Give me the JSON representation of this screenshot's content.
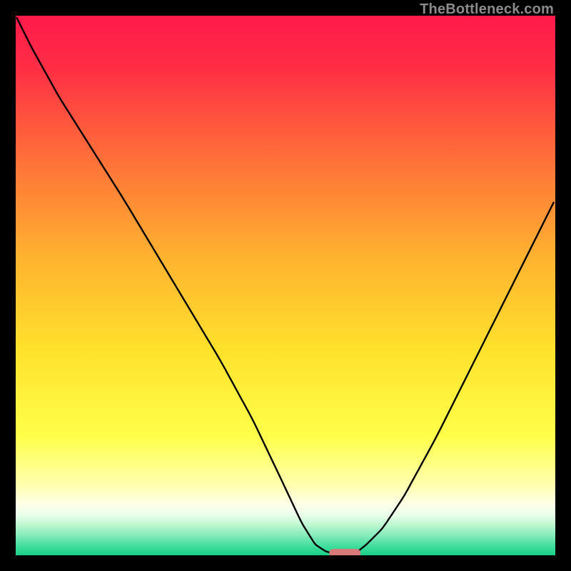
{
  "watermark": "TheBottleneck.com",
  "colors": {
    "frame": "#000000",
    "curve": "#000000",
    "marker": "#d87a7a",
    "gradient_stops": [
      {
        "offset": 0.0,
        "color": "#ff1a4b"
      },
      {
        "offset": 0.1,
        "color": "#ff2f45"
      },
      {
        "offset": 0.25,
        "color": "#ff6a3a"
      },
      {
        "offset": 0.45,
        "color": "#ffb330"
      },
      {
        "offset": 0.62,
        "color": "#ffe22c"
      },
      {
        "offset": 0.78,
        "color": "#ffff4a"
      },
      {
        "offset": 0.87,
        "color": "#ffffb0"
      },
      {
        "offset": 0.905,
        "color": "#ffffe8"
      },
      {
        "offset": 0.925,
        "color": "#eaffea"
      },
      {
        "offset": 0.945,
        "color": "#baf7cf"
      },
      {
        "offset": 0.965,
        "color": "#7fe9b8"
      },
      {
        "offset": 0.985,
        "color": "#3bdc9b"
      },
      {
        "offset": 1.0,
        "color": "#18cf86"
      }
    ]
  },
  "chart_data": {
    "type": "line",
    "title": "",
    "xlabel": "",
    "ylabel": "",
    "xlim": [
      0,
      100
    ],
    "ylim": [
      0,
      100
    ],
    "grid": false,
    "legend": false,
    "x": [
      0,
      3,
      8,
      14,
      20,
      26,
      32,
      38,
      44,
      49,
      53,
      55.5,
      57.5,
      59.5,
      61.5,
      63.5,
      65,
      68,
      72,
      78,
      86,
      94,
      100
    ],
    "y": [
      100,
      94,
      85,
      75.5,
      66,
      56,
      46,
      36,
      25,
      14.5,
      6,
      2,
      0.7,
      0.2,
      0.2,
      0.8,
      2,
      5,
      11,
      22,
      38,
      54,
      66
    ],
    "marker": {
      "x": 61,
      "y": 0.4
    },
    "notes": "x is horizontal position (0=left edge of plot, 100=right edge). y is bottleneck percentage (0=bottom/green, 100=top/red). Curve starts off-frame at top-left, descends to a flat minimum near x≈60, then rises toward the right."
  }
}
